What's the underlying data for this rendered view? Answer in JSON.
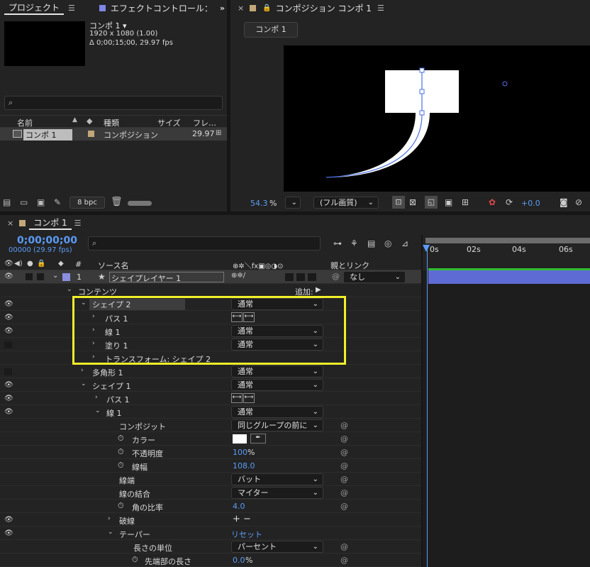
{
  "project": {
    "tab_label": "プロジェクト",
    "effects_tab_label": "エフェクトコントロール：",
    "comp_name": "コンポ 1 ▾",
    "comp_resolution": "1920 x 1080 (1.00)",
    "comp_duration": "Δ 0;00;15;00, 29.97 fps",
    "search_placeholder": "",
    "columns": [
      "名前",
      "種類",
      "サイズ",
      "フレ…"
    ],
    "items": [
      {
        "name": "コンポ 1",
        "type": "コンポジション",
        "fps": "29.97"
      }
    ],
    "bpc_label": "8 bpc"
  },
  "composition": {
    "tab_label": "コンポジション コンポ 1",
    "flow_button": "コンポ 1",
    "zoom_value": "54.3",
    "zoom_unit": "%",
    "quality": "(フル画質)",
    "exposure": "+0.0"
  },
  "timeline": {
    "tab_label": "コンポ 1",
    "timecode": "0;00;00;00",
    "frame_info": "00000 (29.97 fps)",
    "search_placeholder": "",
    "col_hash": "#",
    "col_source": "ソース名",
    "col_parent": "親とリンク",
    "ruler": [
      "0s",
      "02s",
      "04s",
      "06s"
    ],
    "layer": {
      "num": "1",
      "name": "シェイプレイヤー 1",
      "parent": "なし"
    },
    "contents_label": "コンテンツ",
    "add_label": "追加:",
    "rows": {
      "shape2": "シェイプ 2",
      "shape2_mode": "通常",
      "path1a": "パス 1",
      "stroke1a": "線 1",
      "stroke1a_mode": "通常",
      "fill1": "塗り 1",
      "fill1_mode": "通常",
      "transform": "トランスフォーム: シェイプ 2",
      "polygon": "多角形 1",
      "polygon_mode": "通常",
      "shape1": "シェイプ 1",
      "shape1_mode": "通常",
      "path1b": "パス 1",
      "stroke1b": "線 1",
      "stroke1b_mode": "通常",
      "composite": "コンポジット",
      "composite_value": "同じグループの前に",
      "color": "カラー",
      "opacity": "不透明度",
      "opacity_value": "100",
      "opacity_unit": "%",
      "width": "線幅",
      "width_value": "108.0",
      "cap": "線端",
      "cap_value": "バット",
      "join": "線の結合",
      "join_value": "マイター",
      "miter": "角の比率",
      "miter_value": "4.0",
      "dashes": "破線",
      "taper": "テーパー",
      "reset": "リセット",
      "length_units": "長さの単位",
      "length_units_value": "パーセント",
      "start_length": "先端部の長さ",
      "start_length_value": "0.0",
      "start_length_unit": "%"
    }
  },
  "colors": {
    "accent_blue": "#5b9bf5",
    "highlight_yellow": "#f1ef2a",
    "layer_bar": "#5f6bd4",
    "label_swatch": "#8a8fe0",
    "comp_swatch": "#c2a878"
  }
}
